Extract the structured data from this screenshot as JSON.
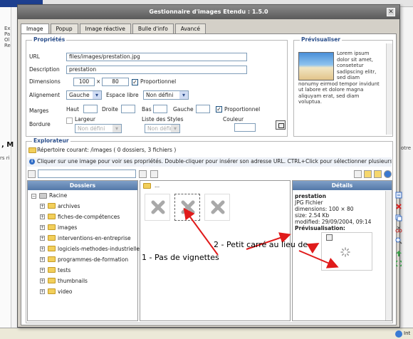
{
  "background": {
    "left_lines": [
      "Ex",
      "Pa",
      "Ol",
      "Re"
    ],
    "bold_fragment": ", M",
    "side_text_left": "rs ri",
    "side_text_right": "otre",
    "status_label": "Int"
  },
  "dialog": {
    "title": "Gestionnaire d'images Etendu : 1.5.0",
    "close_glyph": "✕",
    "tabs": [
      "Image",
      "Popup",
      "Image réactive",
      "Bulle d'info",
      "Avancé"
    ]
  },
  "properties": {
    "legend": "Propriétés",
    "url_label": "URL",
    "url_value": "files/images/prestation.jpg",
    "description_label": "Description",
    "description_value": "prestation",
    "dimensions_label": "Dimensions",
    "width": "100",
    "times": "×",
    "height": "80",
    "proportional_label": "Proportionnel",
    "alignment_label": "Alignement",
    "alignment_value": "Gauche",
    "spacing_label": "Espace libre",
    "spacing_value": "Non défini",
    "margins_label": "Marges",
    "top_label": "Haut",
    "right_label": "Droite",
    "bottom_label": "Bas",
    "left_label": "Gauche",
    "margins_proportional_label": "Proportionnel",
    "border_label": "Bordure",
    "border_width_label": "Largeur",
    "border_width_value": "Non défini",
    "styles_label": "Liste des Styles",
    "styles_value": "Non défini",
    "color_label": "Couleur"
  },
  "preview": {
    "legend": "Prévisualiser",
    "text_lines": [
      "Lorem ipsum",
      "dolor sit amet,",
      "consetetur",
      "sadipscing elitr,",
      "sed diam",
      "nonumy eirmod tempor invidunt",
      "ut labore et dolore magna",
      "aliquyam erat, sed diam",
      "voluptua."
    ]
  },
  "explorer": {
    "legend": "Explorateur",
    "current_dir": "Répertoire courant: /images ( 0 dossiers, 3 fichiers )",
    "info_text": "Cliquer sur une image pour voir ses propriétés. Double-cliquer pour insérer son adresse URL. CTRL+Click pour sélectionner plusieurs images",
    "folders_header": "Dossiers",
    "root_label": "Racine",
    "folders": [
      "archives",
      "fiches-de-compétences",
      "images",
      "interventions-en-entreprise",
      "logiciels-methodes-industrielle",
      "programmes-de-formation",
      "tests",
      "thumbnails",
      "video"
    ],
    "up_label": "...",
    "details_header": "Détails",
    "details": {
      "name": "prestation",
      "type": "JPG Fichier",
      "dimensions": "dimensions: 100 × 80",
      "size": "size: 2.54 Kb",
      "modified": "modified: 29/09/2004, 09:14",
      "preview_label": "Prévisualisation:"
    }
  },
  "annotations": {
    "note1": "1 - Pas de vignettes",
    "note2": "2 - Petit carré au lieu de"
  },
  "colors": {
    "legend_blue": "#2b4f8c",
    "header_blue": "#5478a8",
    "arrow_red": "#e01b1b",
    "error_red": "#d62020",
    "folder_yellow": "#f2cf5b"
  }
}
